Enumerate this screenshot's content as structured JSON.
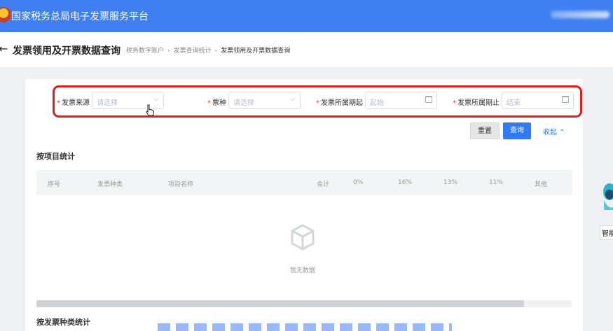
{
  "header": {
    "title": "国家税务总局电子发票服务平台"
  },
  "breadcrumb": {
    "page_title": "发票领用及开票数据查询",
    "items": [
      "税务数字账户",
      "发票查询统计",
      "发票领用及开票数据查询"
    ]
  },
  "filters": {
    "source": {
      "label": "发票来源",
      "placeholder": "请选择"
    },
    "ticket_type": {
      "label": "票种",
      "placeholder": "请选择"
    },
    "period_start": {
      "label": "发票所属期起",
      "placeholder": "起始"
    },
    "period_end": {
      "label": "发票所属期止",
      "placeholder": "结束"
    }
  },
  "actions": {
    "reset_label": "重置",
    "query_label": "查询",
    "collapse_label": "收起"
  },
  "section_project": {
    "title": "按项目统计",
    "columns": [
      "序号",
      "发票种类",
      "项目名称",
      "合计",
      "0%",
      "16%",
      "13%",
      "11%",
      "其他"
    ],
    "empty_text": "暂无数据"
  },
  "section_type": {
    "title": "按发票种类统计"
  },
  "assistant": {
    "label": "智能"
  },
  "colors": {
    "header_blue": "#3f7ff2",
    "primary": "#2f7bf5",
    "highlight_red": "#e31b1b"
  }
}
